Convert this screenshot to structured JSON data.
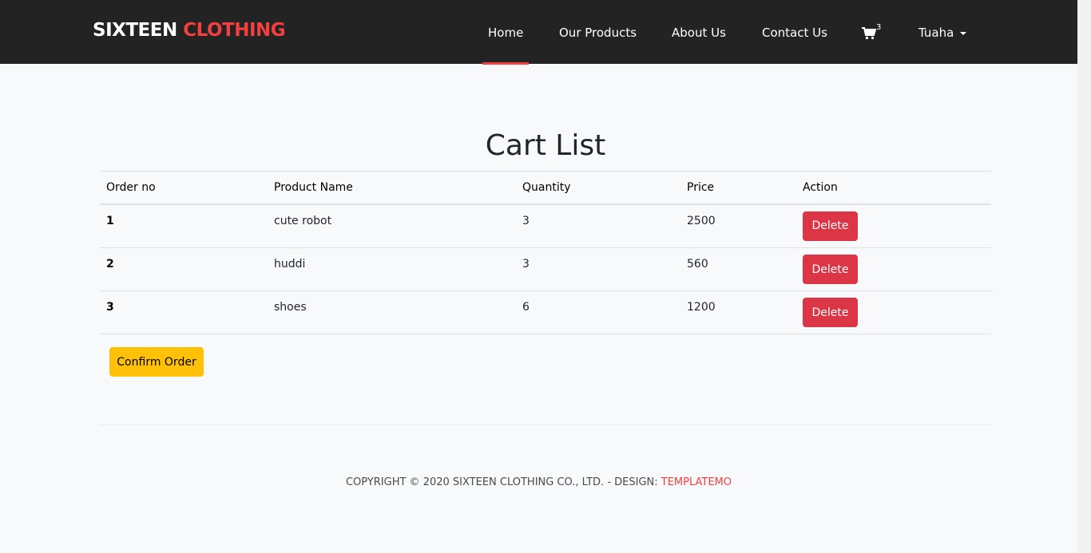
{
  "header": {
    "brand_part1": "SIXTEEN",
    "brand_part2": "CLOTHING",
    "nav": {
      "home": "Home",
      "products": "Our Products",
      "about": "About Us",
      "contact": "Contact Us"
    },
    "cart_count": "3",
    "user": "Tuaha"
  },
  "main": {
    "title": "Cart List",
    "columns": [
      "Order no",
      "Product Name",
      "Quantity",
      "Price",
      "Action"
    ],
    "rows": [
      {
        "order": "1",
        "product": "cute robot",
        "quantity": "3",
        "price": "2500",
        "action": "Delete"
      },
      {
        "order": "2",
        "product": "huddi",
        "quantity": "3",
        "price": "560",
        "action": "Delete"
      },
      {
        "order": "3",
        "product": "shoes",
        "quantity": "6",
        "price": "1200",
        "action": "Delete"
      }
    ],
    "confirm_label": "Confirm Order"
  },
  "footer": {
    "text": "COPYRIGHT © 2020 SIXTEEN CLOTHING CO., LTD. - DESIGN: ",
    "link": "TEMPLATEMO"
  },
  "colors": {
    "accent": "#f33f3f",
    "header_bg": "#232323",
    "delete": "#dc3545",
    "confirm": "#ffc107"
  }
}
